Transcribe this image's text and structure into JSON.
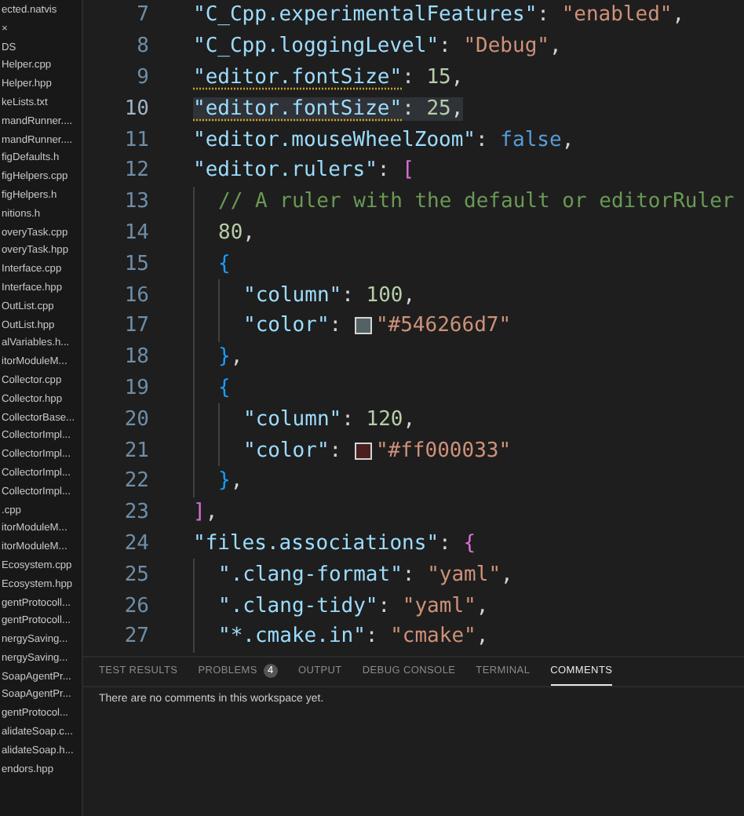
{
  "explorer": {
    "items": [
      {
        "label": "ected.natvis",
        "selected": false
      },
      {
        "label": "×",
        "selected": false
      },
      {
        "label": "DS",
        "selected": false
      },
      {
        "label": "Helper.cpp",
        "selected": false
      },
      {
        "label": "Helper.hpp",
        "selected": false
      },
      {
        "label": "keLists.txt",
        "selected": false
      },
      {
        "label": "mandRunner....",
        "selected": false
      },
      {
        "label": "mandRunner....",
        "selected": false
      },
      {
        "label": "figDefaults.h",
        "selected": false
      },
      {
        "label": "figHelpers.cpp",
        "selected": false
      },
      {
        "label": "figHelpers.h",
        "selected": false
      },
      {
        "label": "nitions.h",
        "selected": false
      },
      {
        "label": "overyTask.cpp",
        "selected": false
      },
      {
        "label": "overyTask.hpp",
        "selected": false
      },
      {
        "label": "Interface.cpp",
        "selected": false
      },
      {
        "label": "Interface.hpp",
        "selected": false
      },
      {
        "label": "OutList.cpp",
        "selected": false
      },
      {
        "label": "OutList.hpp",
        "selected": false
      },
      {
        "label": "alVariables.h...",
        "selected": false
      },
      {
        "label": "itorModuleM...",
        "selected": false
      },
      {
        "label": "Collector.cpp",
        "selected": false
      },
      {
        "label": "Collector.hpp",
        "selected": false
      },
      {
        "label": "CollectorBase...",
        "selected": false
      },
      {
        "label": "CollectorImpl...",
        "selected": false
      },
      {
        "label": "CollectorImpl...",
        "selected": false
      },
      {
        "label": "CollectorImpl...",
        "selected": false
      },
      {
        "label": "CollectorImpl...",
        "selected": false
      },
      {
        "label": ".cpp",
        "selected": false
      },
      {
        "label": "itorModuleM...",
        "selected": false
      },
      {
        "label": "itorModuleM...",
        "selected": false
      },
      {
        "label": "Ecosystem.cpp",
        "selected": false
      },
      {
        "label": "Ecosystem.hpp",
        "selected": false
      },
      {
        "label": "gentProtocoll...",
        "selected": false
      },
      {
        "label": "gentProtocoll...",
        "selected": false
      },
      {
        "label": "nergySaving...",
        "selected": false
      },
      {
        "label": "nergySaving...",
        "selected": false
      },
      {
        "label": "SoapAgentPr...",
        "selected": false
      },
      {
        "label": "SoapAgentPr...",
        "selected": false
      },
      {
        "label": "gentProtocol...",
        "selected": false
      },
      {
        "label": "alidateSoap.c...",
        "selected": false
      },
      {
        "label": "alidateSoap.h...",
        "selected": false
      },
      {
        "label": "endors.hpp",
        "selected": false
      }
    ]
  },
  "editor": {
    "lines": [
      {
        "number": "7",
        "highlighted": false,
        "tokens": [
          {
            "kind": "indent"
          },
          {
            "kind": "key",
            "text": "\"C_Cpp.experimentalFeatures\""
          },
          {
            "kind": "punct",
            "text": ": "
          },
          {
            "kind": "string",
            "text": "\"enabled\""
          },
          {
            "kind": "punct",
            "text": ","
          }
        ]
      },
      {
        "number": "8",
        "highlighted": false,
        "tokens": [
          {
            "kind": "indent"
          },
          {
            "kind": "key",
            "text": "\"C_Cpp.loggingLevel\""
          },
          {
            "kind": "punct",
            "text": ": "
          },
          {
            "kind": "string",
            "text": "\"Debug\""
          },
          {
            "kind": "punct",
            "text": ","
          }
        ]
      },
      {
        "number": "9",
        "highlighted": false,
        "tokens": [
          {
            "kind": "indent"
          },
          {
            "kind": "key",
            "text": "\"editor.fontSize\"",
            "squiggle": true
          },
          {
            "kind": "punct",
            "text": ": "
          },
          {
            "kind": "number",
            "text": "15"
          },
          {
            "kind": "punct",
            "text": ","
          }
        ]
      },
      {
        "number": "10",
        "highlighted": true,
        "tokens": [
          {
            "kind": "indent"
          },
          {
            "kind": "key",
            "text": "\"editor.fontSize\"",
            "squiggle": true
          },
          {
            "kind": "punct",
            "text": ": "
          },
          {
            "kind": "number",
            "text": "25"
          },
          {
            "kind": "punct",
            "text": ","
          }
        ]
      },
      {
        "number": "11",
        "highlighted": false,
        "tokens": [
          {
            "kind": "indent"
          },
          {
            "kind": "key",
            "text": "\"editor.mouseWheelZoom\""
          },
          {
            "kind": "punct",
            "text": ": "
          },
          {
            "kind": "keyword",
            "text": "false"
          },
          {
            "kind": "punct",
            "text": ","
          }
        ]
      },
      {
        "number": "12",
        "highlighted": false,
        "tokens": [
          {
            "kind": "indent"
          },
          {
            "kind": "key",
            "text": "\"editor.rulers\""
          },
          {
            "kind": "punct",
            "text": ": "
          },
          {
            "kind": "bracket-pink",
            "text": "["
          }
        ]
      },
      {
        "number": "13",
        "highlighted": false,
        "tokens": [
          {
            "kind": "indent"
          },
          {
            "kind": "indent"
          },
          {
            "kind": "comment",
            "text": "// A ruler with the default or editorRuler"
          }
        ]
      },
      {
        "number": "14",
        "highlighted": false,
        "tokens": [
          {
            "kind": "indent"
          },
          {
            "kind": "indent"
          },
          {
            "kind": "number",
            "text": "80"
          },
          {
            "kind": "punct",
            "text": ","
          }
        ]
      },
      {
        "number": "15",
        "highlighted": false,
        "tokens": [
          {
            "kind": "indent"
          },
          {
            "kind": "indent"
          },
          {
            "kind": "bracket-blue",
            "text": "{"
          }
        ]
      },
      {
        "number": "16",
        "highlighted": false,
        "tokens": [
          {
            "kind": "indent"
          },
          {
            "kind": "indent"
          },
          {
            "kind": "indent"
          },
          {
            "kind": "key",
            "text": "\"column\""
          },
          {
            "kind": "punct",
            "text": ": "
          },
          {
            "kind": "number",
            "text": "100"
          },
          {
            "kind": "punct",
            "text": ","
          }
        ]
      },
      {
        "number": "17",
        "highlighted": false,
        "tokens": [
          {
            "kind": "indent"
          },
          {
            "kind": "indent"
          },
          {
            "kind": "indent"
          },
          {
            "kind": "key",
            "text": "\"color\""
          },
          {
            "kind": "punct",
            "text": ": "
          },
          {
            "kind": "swatch",
            "color": "#546266"
          },
          {
            "kind": "string",
            "text": "\"#546266d7\""
          }
        ]
      },
      {
        "number": "18",
        "highlighted": false,
        "tokens": [
          {
            "kind": "indent"
          },
          {
            "kind": "indent"
          },
          {
            "kind": "bracket-blue",
            "text": "}"
          },
          {
            "kind": "punct",
            "text": ","
          }
        ]
      },
      {
        "number": "19",
        "highlighted": false,
        "tokens": [
          {
            "kind": "indent"
          },
          {
            "kind": "indent"
          },
          {
            "kind": "bracket-blue",
            "text": "{"
          }
        ]
      },
      {
        "number": "20",
        "highlighted": false,
        "tokens": [
          {
            "kind": "indent"
          },
          {
            "kind": "indent"
          },
          {
            "kind": "indent"
          },
          {
            "kind": "key",
            "text": "\"column\""
          },
          {
            "kind": "punct",
            "text": ": "
          },
          {
            "kind": "number",
            "text": "120"
          },
          {
            "kind": "punct",
            "text": ","
          }
        ]
      },
      {
        "number": "21",
        "highlighted": false,
        "tokens": [
          {
            "kind": "indent"
          },
          {
            "kind": "indent"
          },
          {
            "kind": "indent"
          },
          {
            "kind": "key",
            "text": "\"color\""
          },
          {
            "kind": "punct",
            "text": ": "
          },
          {
            "kind": "swatch",
            "color": "#4a1f1f"
          },
          {
            "kind": "string",
            "text": "\"#ff000033\""
          }
        ]
      },
      {
        "number": "22",
        "highlighted": false,
        "tokens": [
          {
            "kind": "indent"
          },
          {
            "kind": "indent"
          },
          {
            "kind": "bracket-blue",
            "text": "}"
          },
          {
            "kind": "punct",
            "text": ","
          }
        ]
      },
      {
        "number": "23",
        "highlighted": false,
        "tokens": [
          {
            "kind": "indent"
          },
          {
            "kind": "bracket-pink",
            "text": "]"
          },
          {
            "kind": "punct",
            "text": ","
          }
        ]
      },
      {
        "number": "24",
        "highlighted": false,
        "tokens": [
          {
            "kind": "indent"
          },
          {
            "kind": "key",
            "text": "\"files.associations\""
          },
          {
            "kind": "punct",
            "text": ": "
          },
          {
            "kind": "bracket-pink",
            "text": "{"
          }
        ]
      },
      {
        "number": "25",
        "highlighted": false,
        "tokens": [
          {
            "kind": "indent"
          },
          {
            "kind": "indent"
          },
          {
            "kind": "key",
            "text": "\".clang-format\""
          },
          {
            "kind": "punct",
            "text": ": "
          },
          {
            "kind": "string",
            "text": "\"yaml\""
          },
          {
            "kind": "punct",
            "text": ","
          }
        ]
      },
      {
        "number": "26",
        "highlighted": false,
        "tokens": [
          {
            "kind": "indent"
          },
          {
            "kind": "indent"
          },
          {
            "kind": "key",
            "text": "\".clang-tidy\""
          },
          {
            "kind": "punct",
            "text": ": "
          },
          {
            "kind": "string",
            "text": "\"yaml\""
          },
          {
            "kind": "punct",
            "text": ","
          }
        ]
      },
      {
        "number": "27",
        "highlighted": false,
        "tokens": [
          {
            "kind": "indent"
          },
          {
            "kind": "indent"
          },
          {
            "kind": "key",
            "text": "\"*.cmake.in\""
          },
          {
            "kind": "punct",
            "text": ": "
          },
          {
            "kind": "string",
            "text": "\"cmake\""
          },
          {
            "kind": "punct",
            "text": ","
          }
        ]
      }
    ]
  },
  "panel": {
    "tabs": [
      {
        "label": "TEST RESULTS",
        "selected": false
      },
      {
        "label": "PROBLEMS",
        "badge": "4",
        "selected": false
      },
      {
        "label": "OUTPUT",
        "selected": false
      },
      {
        "label": "DEBUG CONSOLE",
        "selected": false
      },
      {
        "label": "TERMINAL",
        "selected": false
      },
      {
        "label": "COMMENTS",
        "selected": true
      }
    ],
    "message": "There are no comments in this workspace yet."
  }
}
